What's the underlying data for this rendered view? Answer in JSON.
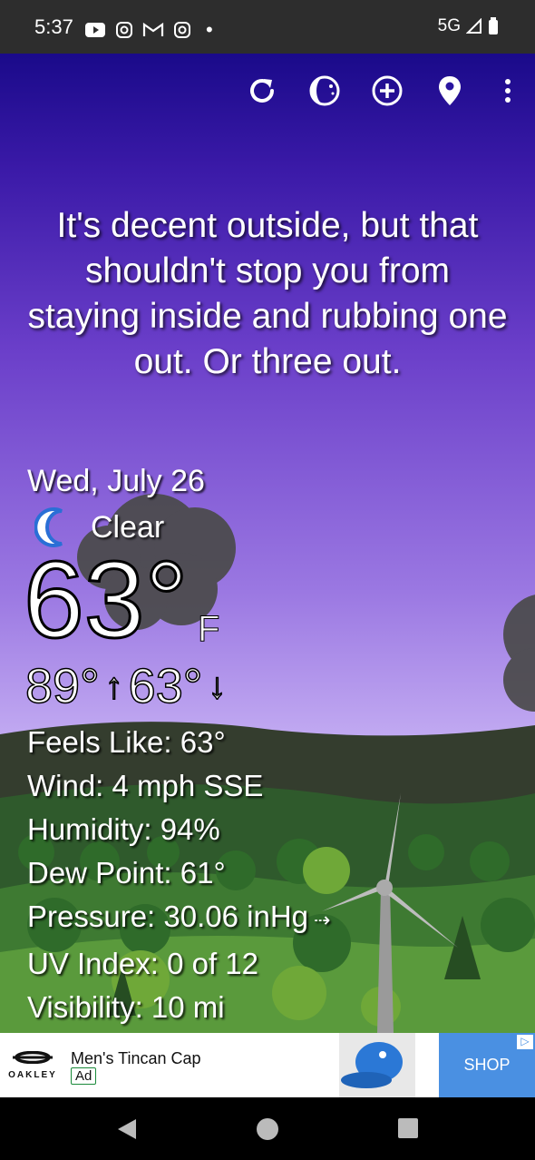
{
  "status_bar": {
    "time": "5:37",
    "notification_icons": [
      "youtube-icon",
      "instagram-icon",
      "gmail-icon",
      "instagram-icon"
    ],
    "network": "5G"
  },
  "toolbar": {
    "icons": [
      "refresh-icon",
      "theme-icon",
      "add-location-icon",
      "location-pin-icon",
      "more-vert-icon"
    ]
  },
  "quote": "It's decent outside, but that shouldn't stop you from staying inside and rubbing one out. Or three out.",
  "weather": {
    "date": "Wed, July 26",
    "condition": "Clear",
    "temperature": "63°",
    "unit": "F",
    "high": "89°",
    "low": "63°",
    "details": {
      "feels_like": "Feels Like:  63°",
      "wind": "Wind:  4 mph SSE",
      "humidity": "Humidity:  94%",
      "dew_point": "Dew Point:  61°",
      "pressure": "Pressure:  30.06 inHg",
      "uv_index": "UV Index:  0 of 12",
      "visibility": "Visibility:  10 mi"
    }
  },
  "ad": {
    "brand": "OAKLEY",
    "title": "Men's Tincan Cap",
    "badge": "Ad",
    "cta": "SHOP"
  },
  "colors": {
    "sky_top": "#1a0a8a",
    "sky_bottom": "#d6c6f8",
    "ad_cta": "#4a90e2"
  }
}
